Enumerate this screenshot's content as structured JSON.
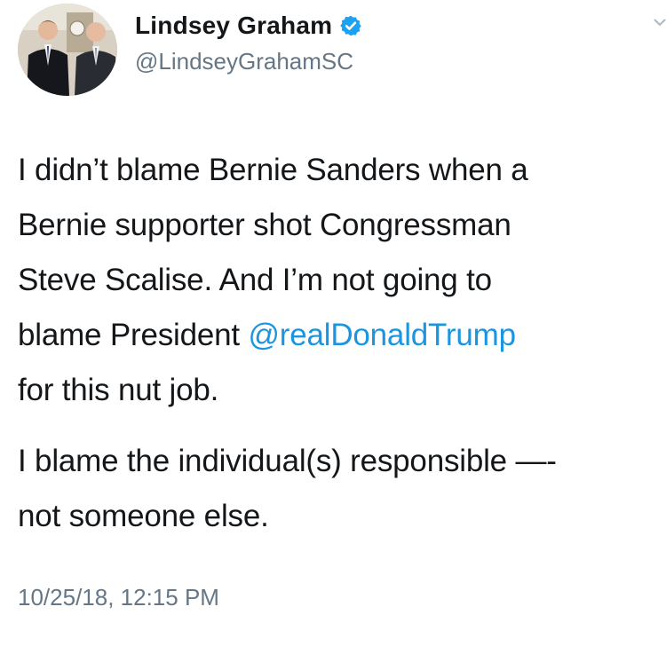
{
  "user": {
    "display_name": "Lindsey Graham",
    "handle": "@LindseyGrahamSC",
    "verified": true,
    "avatar_icon": "profile-photo"
  },
  "tweet": {
    "paragraph1": {
      "line1": "I didn’t blame Bernie Sanders when a",
      "line2": "Bernie supporter shot Congressman",
      "line3": "Steve Scalise.  And I’m not going to",
      "line4_prefix": "blame President ",
      "line4_mention": "@realDonaldTrump",
      "line5": "for this nut job."
    },
    "paragraph2": {
      "line1": "I blame the individual(s) responsible —-",
      "line2": "not someone else."
    },
    "timestamp": "10/25/18, 12:15 PM"
  },
  "colors": {
    "text": "#14171a",
    "secondary": "#657786",
    "link": "#1b95e0",
    "verified_badge": "#1da1f2"
  }
}
